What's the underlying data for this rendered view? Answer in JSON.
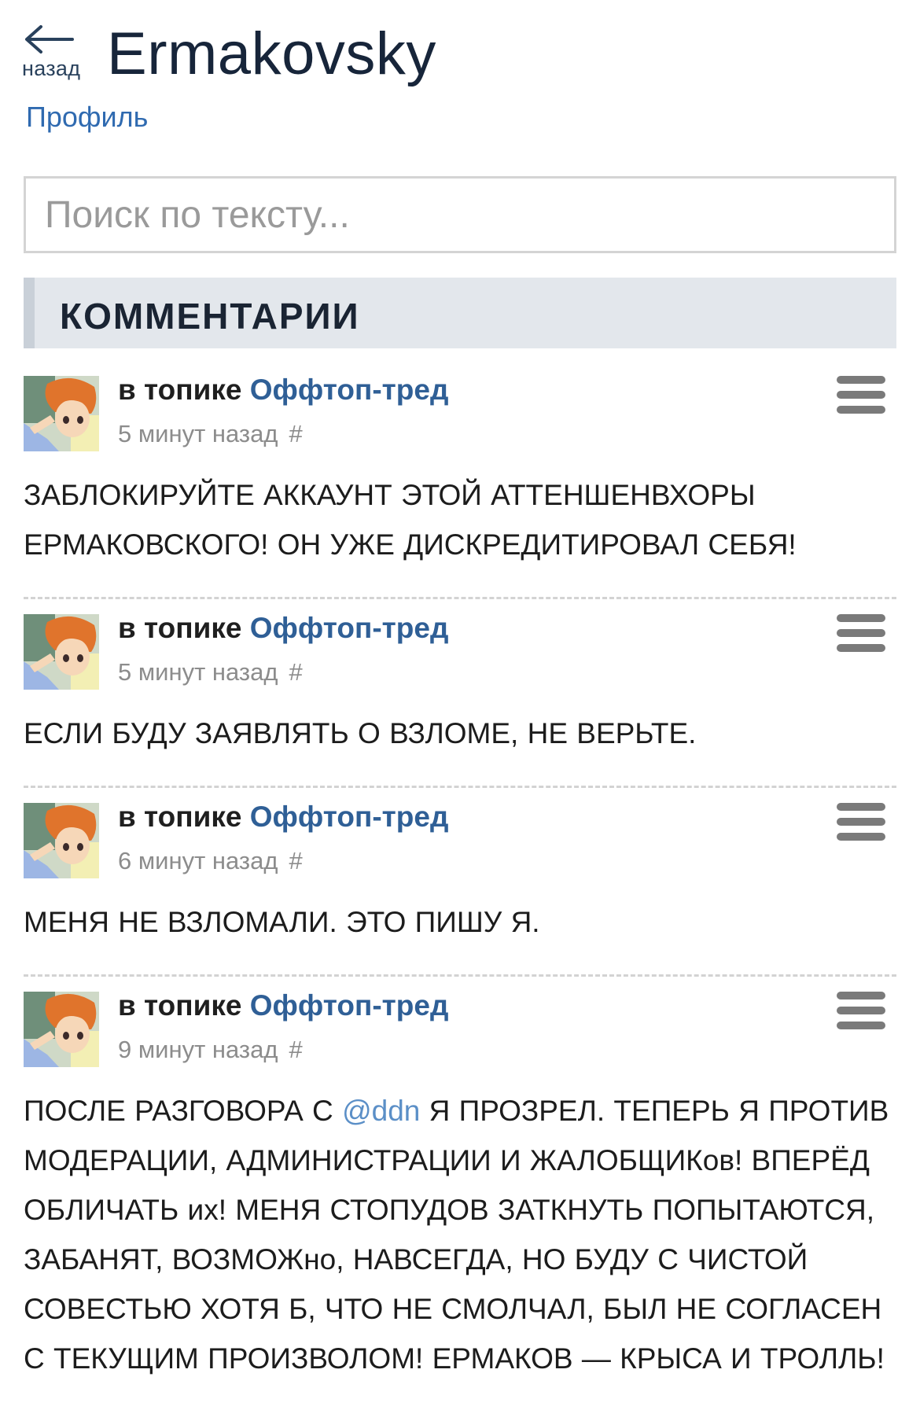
{
  "header": {
    "back_label": "назад",
    "title": "Ermakovsky"
  },
  "profile_link": "Профиль",
  "search": {
    "placeholder": "Поиск по тексту..."
  },
  "section_title": "КОММЕНТАРИИ",
  "comments": [
    {
      "prefix": "в топике",
      "topic": "Оффтоп-тред",
      "time": "5 минут назад",
      "hash": "#",
      "text": "ЗАБЛОКИРУЙТЕ АККАУНТ ЭТОЙ АТТЕНШЕНВХОРЫ ЕРМАКОВСКОГО! ОН УЖЕ ДИСКРЕДИТИРОВАЛ СЕБЯ!"
    },
    {
      "prefix": "в топике",
      "topic": "Оффтоп-тред",
      "time": "5 минут назад",
      "hash": "#",
      "text": "ЕСЛИ БУДУ ЗАЯВЛЯТЬ О ВЗЛОМЕ, НЕ ВЕРЬТЕ."
    },
    {
      "prefix": "в топике",
      "topic": "Оффтоп-тред",
      "time": "6 минут назад",
      "hash": "#",
      "text": "МЕНЯ НЕ ВЗЛОМАЛИ. ЭТО ПИШУ Я."
    },
    {
      "prefix": "в топике",
      "topic": "Оффтоп-тред",
      "time": "9 минут назад",
      "hash": "#",
      "text_before": "ПОСЛЕ РАЗГОВОРА С ",
      "mention": "@ddn",
      "text_after": " Я ПРОЗРЕЛ. ТЕПЕРЬ Я ПРОТИВ МОДЕРАЦИИ, АДМИНИСТРАЦИИ И ЖАЛОБЩИКов! ВПЕРЁД ОБЛИЧАТЬ их! МЕНЯ СТОПУДОВ ЗАТКНУТЬ ПОПЫТАЮТСЯ, ЗАБАНЯТ, ВОЗМОЖно, НАВСЕГДА, НО БУДУ С ЧИСТОЙ СОВЕСТЬЮ ХОТЯ Б, ЧТО НЕ СМОЛЧАЛ, БЫЛ НЕ СОГЛАСЕН С ТЕКУЩИМ ПРОИЗВОЛОМ! ЕРМАКОВ — КРЫСА И ТРОЛЛЬ!"
    }
  ],
  "colors": {
    "link": "#2f5f96",
    "mention": "#5b8fc7",
    "meta_gray": "#8c8c8c",
    "section_bg": "#e3e7ec"
  },
  "icons": {
    "back": "left-arrow-icon",
    "menu": "hamburger-menu-icon",
    "avatar": "anime-avatar"
  }
}
